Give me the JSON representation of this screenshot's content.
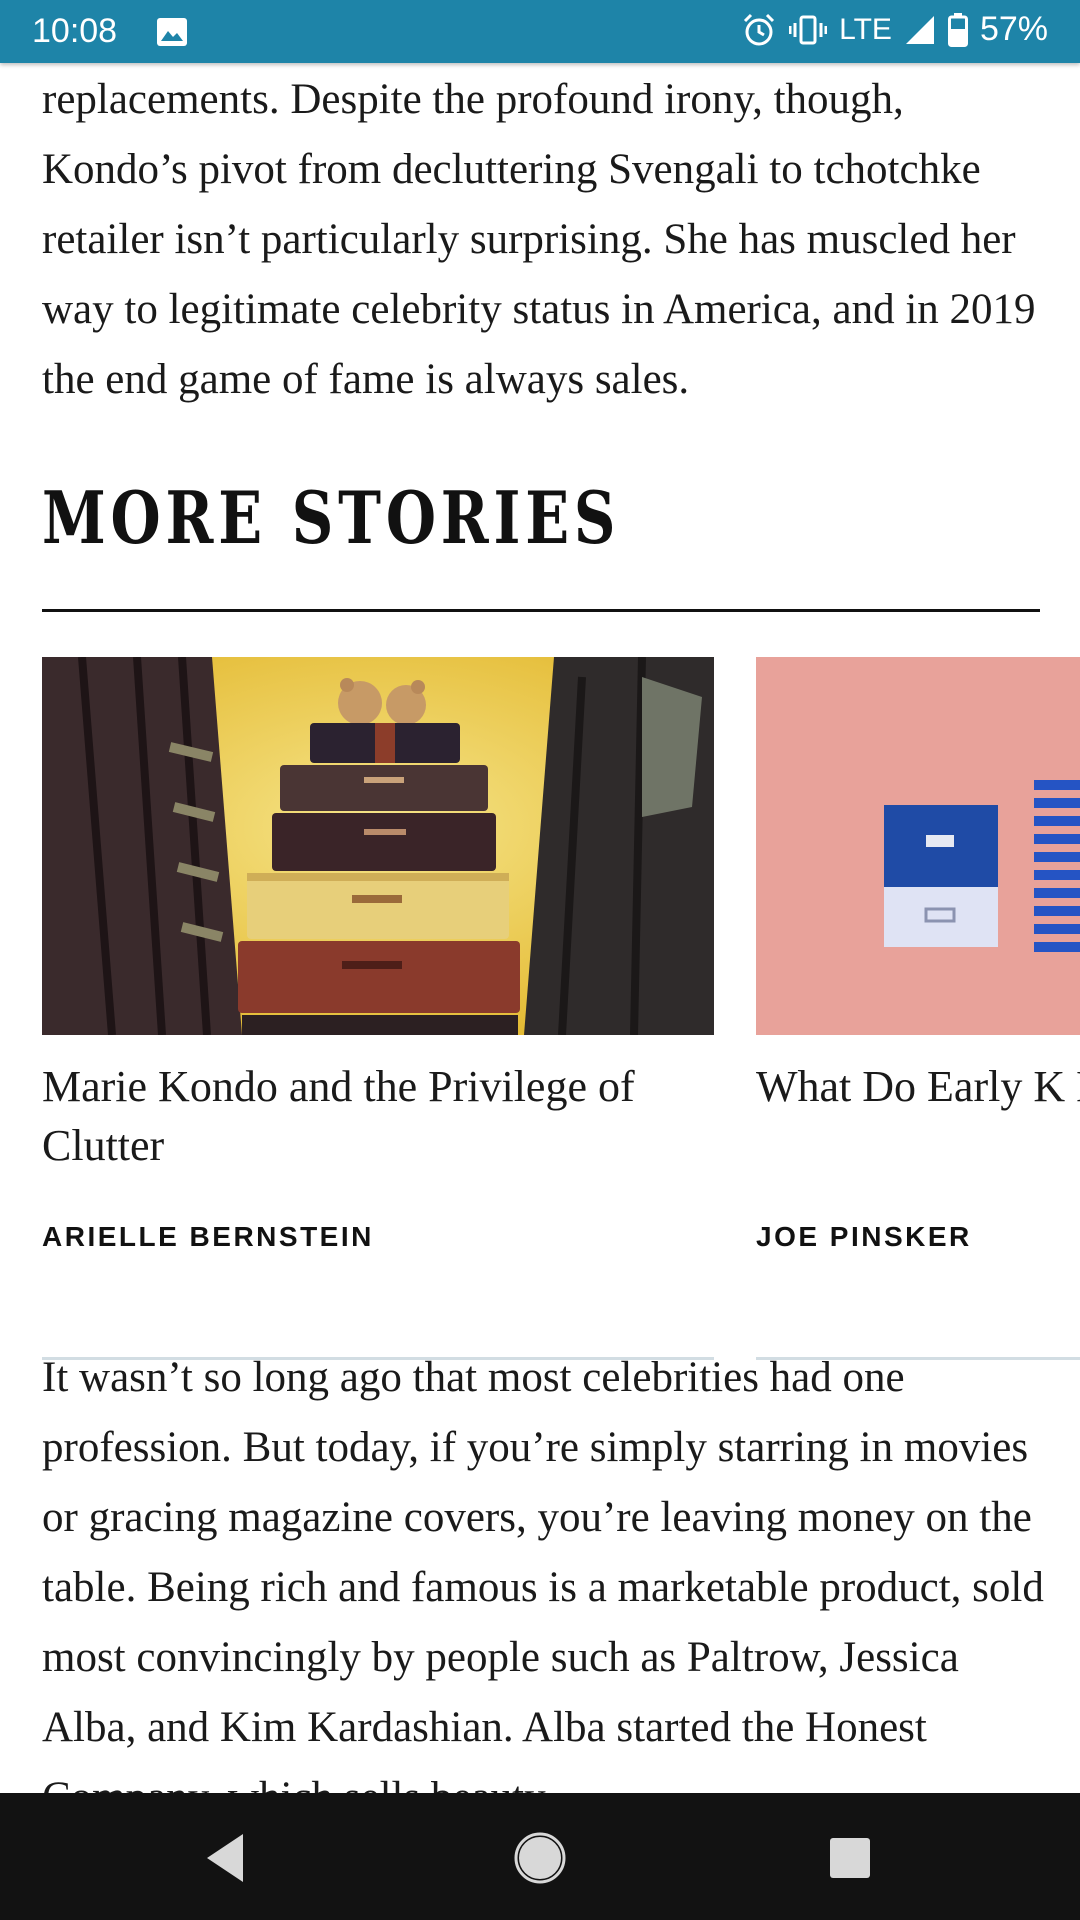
{
  "status_bar": {
    "time": "10:08",
    "network": "LTE",
    "battery": "57%",
    "icons": [
      "image-icon",
      "alarm-icon",
      "vibrate-icon",
      "signal-icon",
      "battery-icon"
    ]
  },
  "article": {
    "paragraph_top": "replacements. Despite the profound irony, though, Kondo’s pivot from decluttering Svengali to tchotchke retailer isn’t particularly surprising. She has muscled her way to legitimate celebrity status in America, and in 2019 the end game of fame is always sales.",
    "paragraph_bottom": "It wasn’t so long ago that most celebrities had one profession. But today, if you’re simply starring in movies or gracing magazine covers, you’re leaving money on the table. Being rich and famous is a marketable product, sold most convincingly by people such as Paltrow, Jessica Alba, and Kim Kardashian. Alba started the Honest Company, which sells beauty"
  },
  "more_stories": {
    "heading": "MORE STORIES",
    "cards": [
      {
        "title": "Marie Kondo and the Privilege of Clutter",
        "byline": "ARIELLE BERNSTEIN",
        "image": "suitcases-stack-image"
      },
      {
        "title": "What Do Early K Homes Look Like",
        "byline": "JOE PINSKER",
        "image": "file-boxes-image"
      }
    ]
  },
  "nav_bar": {
    "buttons": [
      "back-icon",
      "home-icon",
      "recents-icon"
    ]
  },
  "colors": {
    "status_bar": "#1e84a8",
    "nav_bar": "#121212",
    "card_rule": "#d2dde3"
  }
}
